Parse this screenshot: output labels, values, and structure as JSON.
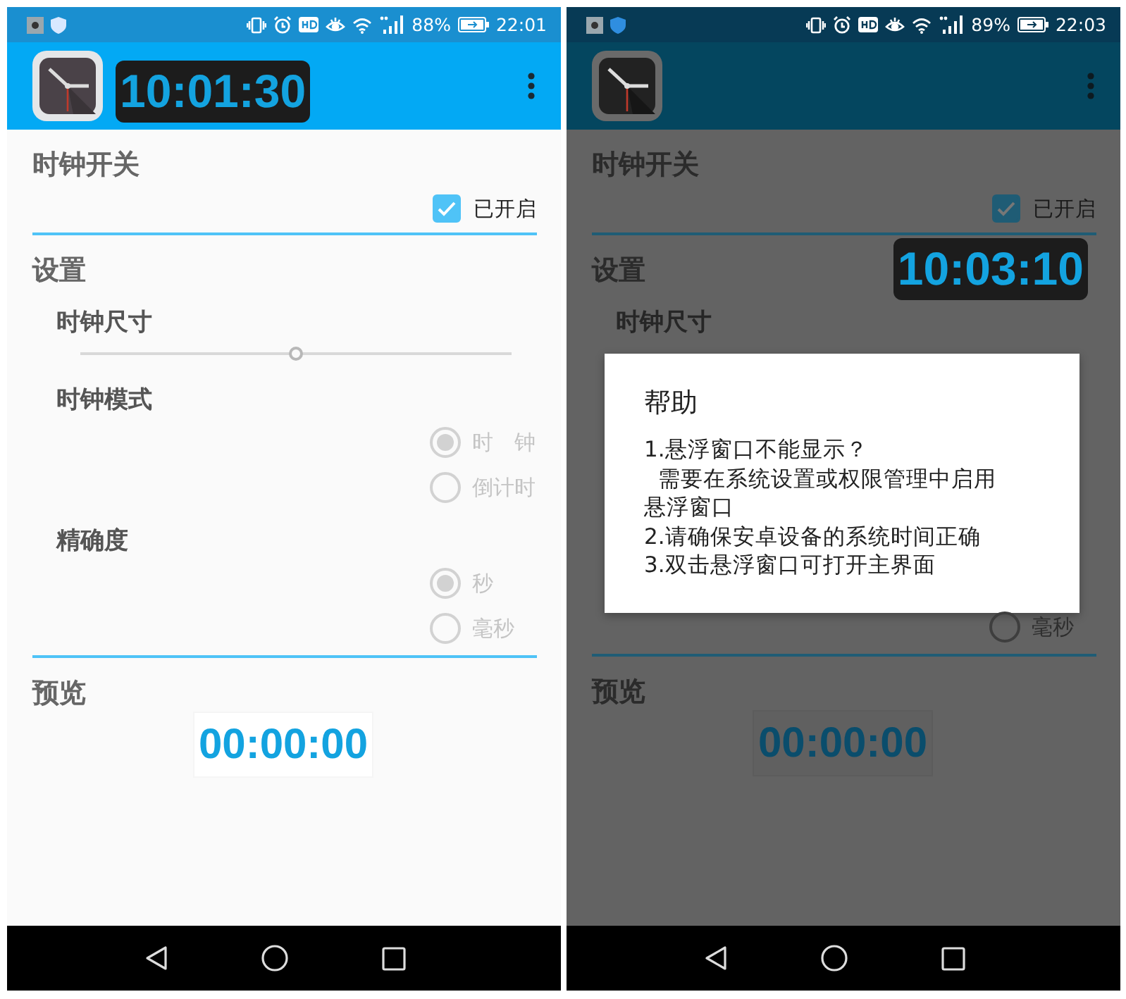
{
  "phones": [
    {
      "dimmed": false,
      "status_bar": {
        "battery": "88%",
        "time": "22:01"
      },
      "app_bar": {
        "floating_clock": "10:01:30"
      },
      "content": [
        {
          "kind": "heading",
          "text": "时钟开关"
        },
        {
          "kind": "checkbox",
          "label": "已开启",
          "checked": true
        },
        {
          "kind": "divider"
        },
        {
          "kind": "heading",
          "text": "设置"
        },
        {
          "kind": "subheading",
          "text": "时钟尺寸"
        },
        {
          "kind": "slider",
          "level": 0.5
        },
        {
          "kind": "subheading",
          "text": "时钟模式"
        },
        {
          "kind": "radio",
          "label": "时　钟",
          "selected": true,
          "disabled": true
        },
        {
          "kind": "radio",
          "label": "倒计时",
          "selected": false,
          "disabled": true
        },
        {
          "kind": "subheading",
          "text": "精确度"
        },
        {
          "kind": "radio",
          "label": "秒",
          "selected": true,
          "disabled": true
        },
        {
          "kind": "radio",
          "label": "毫秒",
          "selected": false,
          "disabled": true
        },
        {
          "kind": "divider"
        },
        {
          "kind": "heading",
          "text": "预览"
        },
        {
          "kind": "preview",
          "text": "00:00:00"
        }
      ]
    },
    {
      "dimmed": true,
      "status_bar": {
        "battery": "89%",
        "time": "22:03"
      },
      "content": [
        {
          "kind": "heading",
          "text": "时钟开关"
        },
        {
          "kind": "checkbox",
          "label": "已开启",
          "checked": true
        },
        {
          "kind": "divider"
        },
        {
          "kind": "heading",
          "text": "设置",
          "floating_clock": "10:03:10"
        },
        {
          "kind": "subheading",
          "text": "时钟尺寸"
        },
        {
          "kind": "dialog",
          "title": "帮助",
          "lines": [
            "1.悬浮窗口不能显示？",
            "  需要在系统设置或权限管理中启用悬浮窗口",
            "2.请确保安卓设备的系统时间正确",
            "3.双击悬浮窗口可打开主界面"
          ]
        },
        {
          "kind": "radio",
          "label": "毫秒",
          "selected": false,
          "disabled": true
        },
        {
          "kind": "divider"
        },
        {
          "kind": "heading",
          "text": "预览"
        },
        {
          "kind": "preview",
          "text": "00:00:00"
        }
      ]
    }
  ]
}
